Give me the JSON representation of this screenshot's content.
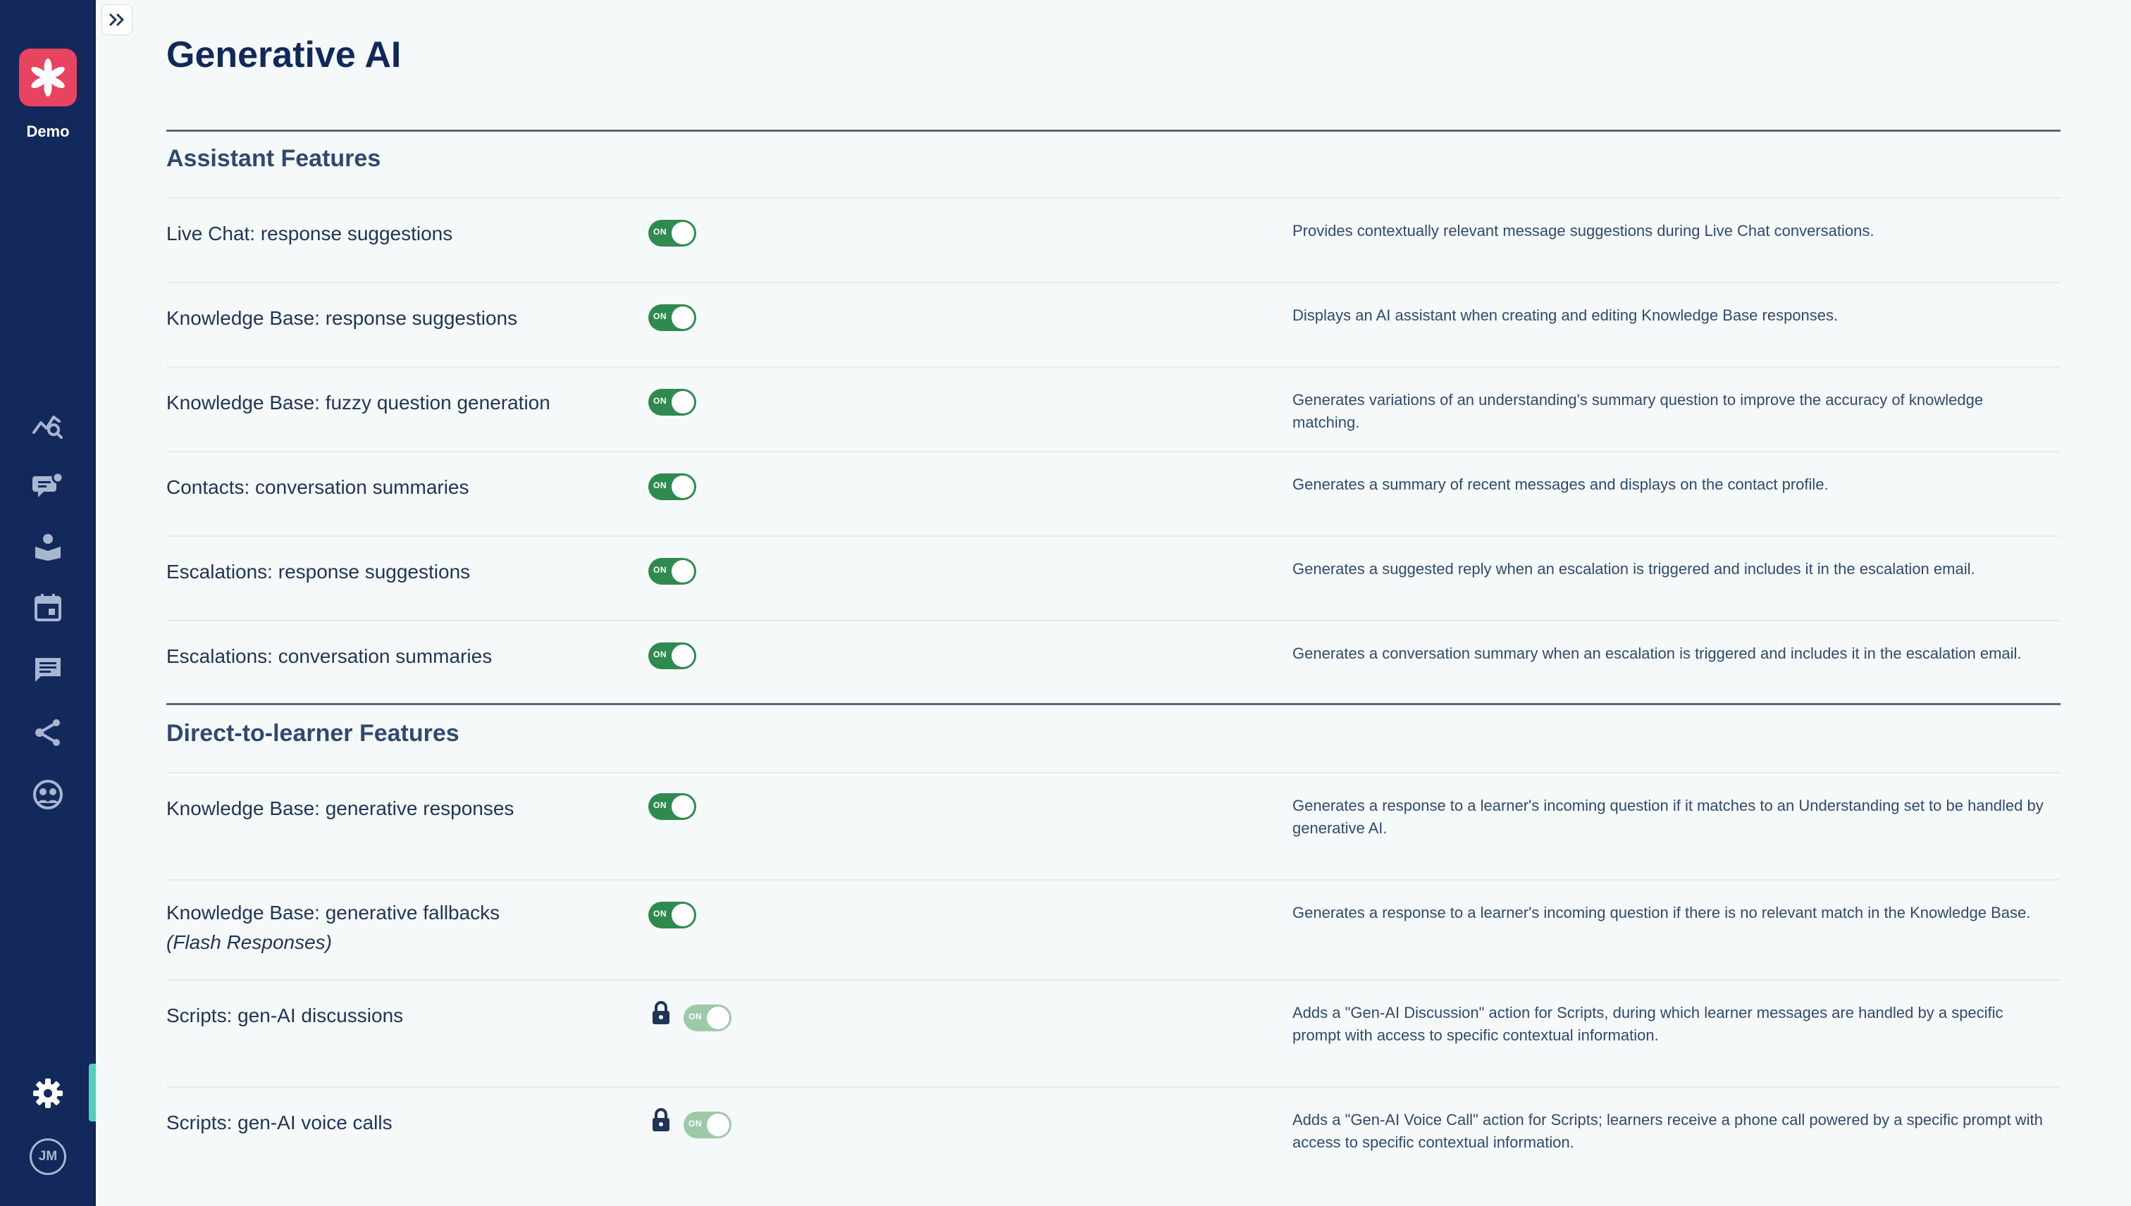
{
  "sidebar": {
    "org_name": "Demo",
    "user_initials": "JM",
    "nav": [
      {
        "icon": "analytics-icon"
      },
      {
        "icon": "conversations-icon"
      },
      {
        "icon": "knowledge-base-icon"
      },
      {
        "icon": "calendar-icon"
      },
      {
        "icon": "messages-icon"
      },
      {
        "icon": "share-icon"
      },
      {
        "icon": "contacts-icon"
      },
      {
        "icon": "gear-icon"
      }
    ],
    "accent": "#4fd1b9"
  },
  "page": {
    "title": "Generative AI"
  },
  "sections": [
    {
      "title": "Assistant Features",
      "features": [
        {
          "label": "Live Chat: response suggestions",
          "state": "ON",
          "desc": "Provides contextually relevant message suggestions during Live Chat conversations."
        },
        {
          "label": "Knowledge Base: response suggestions",
          "state": "ON",
          "desc": "Displays an AI assistant when creating and editing Knowledge Base responses."
        },
        {
          "label": "Knowledge Base: fuzzy question generation",
          "state": "ON",
          "desc": "Generates variations of an understanding's summary question to improve the accuracy of knowledge matching."
        },
        {
          "label": "Contacts: conversation summaries",
          "state": "ON",
          "desc": "Generates a summary of recent messages and displays on the contact profile."
        },
        {
          "label": "Escalations: response suggestions",
          "state": "ON",
          "desc": "Generates a suggested reply when an escalation is triggered and includes it in the escalation email."
        },
        {
          "label": "Escalations: conversation summaries",
          "state": "ON",
          "desc": "Generates a conversation summary when an escalation is triggered and includes it in the escalation email."
        }
      ]
    },
    {
      "title": "Direct-to-learner Features",
      "features": [
        {
          "label": "Knowledge Base: generative responses",
          "state": "ON",
          "desc": "Generates a response to a learner's incoming question if it matches to an Understanding set to be handled by generative AI."
        },
        {
          "label": "Knowledge Base: generative fallbacks",
          "sublabel": "(Flash Responses)",
          "state": "ON",
          "desc": "Generates a response to a learner's incoming question if there is no relevant match in the Knowledge Base."
        },
        {
          "label": "Scripts: gen-AI discussions",
          "state": "ON",
          "locked": true,
          "desc": "Adds a \"Gen-AI Discussion\" action for Scripts, during which learner messages are handled by a specific prompt with access to specific contextual information."
        },
        {
          "label": "Scripts: gen-AI voice calls",
          "state": "ON",
          "locked": true,
          "desc": "Adds a \"Gen-AI Voice Call\" action for Scripts; learners receive a phone call powered by a specific prompt with access to specific contextual information."
        }
      ]
    }
  ],
  "colors": {
    "sidebar_bg": "#13295b",
    "logo_bg": "#e8435f",
    "toggle_on": "#2f8a4e",
    "toggle_locked": "#9ccaa8"
  }
}
